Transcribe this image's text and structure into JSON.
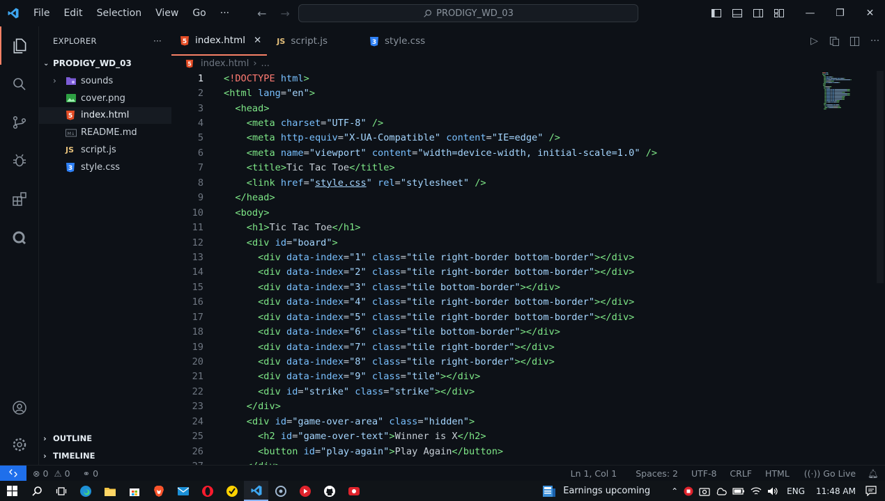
{
  "titlebar": {
    "menu": [
      "File",
      "Edit",
      "Selection",
      "View",
      "Go",
      "···"
    ],
    "search_text": "PRODIGY_WD_03"
  },
  "sidebar": {
    "header": "EXPLORER",
    "more": "···",
    "folder": "PRODIGY_WD_03",
    "items": [
      {
        "label": "sounds",
        "icon": "folder-icon"
      },
      {
        "label": "cover.png",
        "icon": "image-icon"
      },
      {
        "label": "index.html",
        "icon": "html-file-icon"
      },
      {
        "label": "README.md",
        "icon": "markdown-file-icon"
      },
      {
        "label": "script.js",
        "icon": "js-file-icon"
      },
      {
        "label": "style.css",
        "icon": "css-file-icon"
      }
    ],
    "outline": "OUTLINE",
    "timeline": "TIMELINE"
  },
  "tabs": [
    {
      "label": "index.html",
      "icon": "html-file-icon",
      "active": true
    },
    {
      "label": "script.js",
      "icon": "js-file-icon",
      "active": false
    },
    {
      "label": "style.css",
      "icon": "css-file-icon",
      "active": false
    }
  ],
  "breadcrumb": {
    "file": "index.html",
    "rest": "..."
  },
  "code_lines": [
    [
      [
        "p",
        "<"
      ],
      [
        "k",
        "!DOCTYPE"
      ],
      [
        "o",
        " "
      ],
      [
        "a",
        "html"
      ],
      [
        "p",
        ">"
      ]
    ],
    [
      [
        "p",
        "<"
      ],
      [
        "t",
        "html"
      ],
      [
        "o",
        " "
      ],
      [
        "a",
        "lang"
      ],
      [
        "o",
        "="
      ],
      [
        "s",
        "\"en\""
      ],
      [
        "p",
        ">"
      ]
    ],
    [
      [
        "o",
        "  "
      ],
      [
        "p",
        "<"
      ],
      [
        "t",
        "head"
      ],
      [
        "p",
        ">"
      ]
    ],
    [
      [
        "o",
        "    "
      ],
      [
        "p",
        "<"
      ],
      [
        "t",
        "meta"
      ],
      [
        "o",
        " "
      ],
      [
        "a",
        "charset"
      ],
      [
        "o",
        "="
      ],
      [
        "s",
        "\"UTF-8\""
      ],
      [
        "o",
        " "
      ],
      [
        "p",
        "/>"
      ]
    ],
    [
      [
        "o",
        "    "
      ],
      [
        "p",
        "<"
      ],
      [
        "t",
        "meta"
      ],
      [
        "o",
        " "
      ],
      [
        "a",
        "http-equiv"
      ],
      [
        "o",
        "="
      ],
      [
        "s",
        "\"X-UA-Compatible\""
      ],
      [
        "o",
        " "
      ],
      [
        "a",
        "content"
      ],
      [
        "o",
        "="
      ],
      [
        "s",
        "\"IE=edge\""
      ],
      [
        "o",
        " "
      ],
      [
        "p",
        "/>"
      ]
    ],
    [
      [
        "o",
        "    "
      ],
      [
        "p",
        "<"
      ],
      [
        "t",
        "meta"
      ],
      [
        "o",
        " "
      ],
      [
        "a",
        "name"
      ],
      [
        "o",
        "="
      ],
      [
        "s",
        "\"viewport\""
      ],
      [
        "o",
        " "
      ],
      [
        "a",
        "content"
      ],
      [
        "o",
        "="
      ],
      [
        "s",
        "\"width=device-width, initial-scale=1.0\""
      ],
      [
        "o",
        " "
      ],
      [
        "p",
        "/>"
      ]
    ],
    [
      [
        "o",
        "    "
      ],
      [
        "p",
        "<"
      ],
      [
        "t",
        "title"
      ],
      [
        "p",
        ">"
      ],
      [
        "x",
        "Tic Tac Toe"
      ],
      [
        "p",
        "</"
      ],
      [
        "t",
        "title"
      ],
      [
        "p",
        ">"
      ]
    ],
    [
      [
        "o",
        "    "
      ],
      [
        "p",
        "<"
      ],
      [
        "t",
        "link"
      ],
      [
        "o",
        " "
      ],
      [
        "a",
        "href"
      ],
      [
        "o",
        "="
      ],
      [
        "s",
        "\""
      ],
      [
        "l",
        "style.css"
      ],
      [
        "s",
        "\""
      ],
      [
        "o",
        " "
      ],
      [
        "a",
        "rel"
      ],
      [
        "o",
        "="
      ],
      [
        "s",
        "\"stylesheet\""
      ],
      [
        "o",
        " "
      ],
      [
        "p",
        "/>"
      ]
    ],
    [
      [
        "o",
        "  "
      ],
      [
        "p",
        "</"
      ],
      [
        "t",
        "head"
      ],
      [
        "p",
        ">"
      ]
    ],
    [
      [
        "o",
        "  "
      ],
      [
        "p",
        "<"
      ],
      [
        "t",
        "body"
      ],
      [
        "p",
        ">"
      ]
    ],
    [
      [
        "o",
        "    "
      ],
      [
        "p",
        "<"
      ],
      [
        "t",
        "h1"
      ],
      [
        "p",
        ">"
      ],
      [
        "x",
        "Tic Tac Toe"
      ],
      [
        "p",
        "</"
      ],
      [
        "t",
        "h1"
      ],
      [
        "p",
        ">"
      ]
    ],
    [
      [
        "o",
        "    "
      ],
      [
        "p",
        "<"
      ],
      [
        "t",
        "div"
      ],
      [
        "o",
        " "
      ],
      [
        "a",
        "id"
      ],
      [
        "o",
        "="
      ],
      [
        "s",
        "\"board\""
      ],
      [
        "p",
        ">"
      ]
    ],
    [
      [
        "o",
        "      "
      ],
      [
        "p",
        "<"
      ],
      [
        "t",
        "div"
      ],
      [
        "o",
        " "
      ],
      [
        "a",
        "data-index"
      ],
      [
        "o",
        "="
      ],
      [
        "s",
        "\"1\""
      ],
      [
        "o",
        " "
      ],
      [
        "a",
        "class"
      ],
      [
        "o",
        "="
      ],
      [
        "s",
        "\"tile right-border bottom-border\""
      ],
      [
        "p",
        "></"
      ],
      [
        "t",
        "div"
      ],
      [
        "p",
        ">"
      ]
    ],
    [
      [
        "o",
        "      "
      ],
      [
        "p",
        "<"
      ],
      [
        "t",
        "div"
      ],
      [
        "o",
        " "
      ],
      [
        "a",
        "data-index"
      ],
      [
        "o",
        "="
      ],
      [
        "s",
        "\"2\""
      ],
      [
        "o",
        " "
      ],
      [
        "a",
        "class"
      ],
      [
        "o",
        "="
      ],
      [
        "s",
        "\"tile right-border bottom-border\""
      ],
      [
        "p",
        "></"
      ],
      [
        "t",
        "div"
      ],
      [
        "p",
        ">"
      ]
    ],
    [
      [
        "o",
        "      "
      ],
      [
        "p",
        "<"
      ],
      [
        "t",
        "div"
      ],
      [
        "o",
        " "
      ],
      [
        "a",
        "data-index"
      ],
      [
        "o",
        "="
      ],
      [
        "s",
        "\"3\""
      ],
      [
        "o",
        " "
      ],
      [
        "a",
        "class"
      ],
      [
        "o",
        "="
      ],
      [
        "s",
        "\"tile bottom-border\""
      ],
      [
        "p",
        "></"
      ],
      [
        "t",
        "div"
      ],
      [
        "p",
        ">"
      ]
    ],
    [
      [
        "o",
        "      "
      ],
      [
        "p",
        "<"
      ],
      [
        "t",
        "div"
      ],
      [
        "o",
        " "
      ],
      [
        "a",
        "data-index"
      ],
      [
        "o",
        "="
      ],
      [
        "s",
        "\"4\""
      ],
      [
        "o",
        " "
      ],
      [
        "a",
        "class"
      ],
      [
        "o",
        "="
      ],
      [
        "s",
        "\"tile right-border bottom-border\""
      ],
      [
        "p",
        "></"
      ],
      [
        "t",
        "div"
      ],
      [
        "p",
        ">"
      ]
    ],
    [
      [
        "o",
        "      "
      ],
      [
        "p",
        "<"
      ],
      [
        "t",
        "div"
      ],
      [
        "o",
        " "
      ],
      [
        "a",
        "data-index"
      ],
      [
        "o",
        "="
      ],
      [
        "s",
        "\"5\""
      ],
      [
        "o",
        " "
      ],
      [
        "a",
        "class"
      ],
      [
        "o",
        "="
      ],
      [
        "s",
        "\"tile right-border bottom-border\""
      ],
      [
        "p",
        "></"
      ],
      [
        "t",
        "div"
      ],
      [
        "p",
        ">"
      ]
    ],
    [
      [
        "o",
        "      "
      ],
      [
        "p",
        "<"
      ],
      [
        "t",
        "div"
      ],
      [
        "o",
        " "
      ],
      [
        "a",
        "data-index"
      ],
      [
        "o",
        "="
      ],
      [
        "s",
        "\"6\""
      ],
      [
        "o",
        " "
      ],
      [
        "a",
        "class"
      ],
      [
        "o",
        "="
      ],
      [
        "s",
        "\"tile bottom-border\""
      ],
      [
        "p",
        "></"
      ],
      [
        "t",
        "div"
      ],
      [
        "p",
        ">"
      ]
    ],
    [
      [
        "o",
        "      "
      ],
      [
        "p",
        "<"
      ],
      [
        "t",
        "div"
      ],
      [
        "o",
        " "
      ],
      [
        "a",
        "data-index"
      ],
      [
        "o",
        "="
      ],
      [
        "s",
        "\"7\""
      ],
      [
        "o",
        " "
      ],
      [
        "a",
        "class"
      ],
      [
        "o",
        "="
      ],
      [
        "s",
        "\"tile right-border\""
      ],
      [
        "p",
        "></"
      ],
      [
        "t",
        "div"
      ],
      [
        "p",
        ">"
      ]
    ],
    [
      [
        "o",
        "      "
      ],
      [
        "p",
        "<"
      ],
      [
        "t",
        "div"
      ],
      [
        "o",
        " "
      ],
      [
        "a",
        "data-index"
      ],
      [
        "o",
        "="
      ],
      [
        "s",
        "\"8\""
      ],
      [
        "o",
        " "
      ],
      [
        "a",
        "class"
      ],
      [
        "o",
        "="
      ],
      [
        "s",
        "\"tile right-border\""
      ],
      [
        "p",
        "></"
      ],
      [
        "t",
        "div"
      ],
      [
        "p",
        ">"
      ]
    ],
    [
      [
        "o",
        "      "
      ],
      [
        "p",
        "<"
      ],
      [
        "t",
        "div"
      ],
      [
        "o",
        " "
      ],
      [
        "a",
        "data-index"
      ],
      [
        "o",
        "="
      ],
      [
        "s",
        "\"9\""
      ],
      [
        "o",
        " "
      ],
      [
        "a",
        "class"
      ],
      [
        "o",
        "="
      ],
      [
        "s",
        "\"tile\""
      ],
      [
        "p",
        "></"
      ],
      [
        "t",
        "div"
      ],
      [
        "p",
        ">"
      ]
    ],
    [
      [
        "o",
        "      "
      ],
      [
        "p",
        "<"
      ],
      [
        "t",
        "div"
      ],
      [
        "o",
        " "
      ],
      [
        "a",
        "id"
      ],
      [
        "o",
        "="
      ],
      [
        "s",
        "\"strike\""
      ],
      [
        "o",
        " "
      ],
      [
        "a",
        "class"
      ],
      [
        "o",
        "="
      ],
      [
        "s",
        "\"strike\""
      ],
      [
        "p",
        "></"
      ],
      [
        "t",
        "div"
      ],
      [
        "p",
        ">"
      ]
    ],
    [
      [
        "o",
        "    "
      ],
      [
        "p",
        "</"
      ],
      [
        "t",
        "div"
      ],
      [
        "p",
        ">"
      ]
    ],
    [
      [
        "o",
        "    "
      ],
      [
        "p",
        "<"
      ],
      [
        "t",
        "div"
      ],
      [
        "o",
        " "
      ],
      [
        "a",
        "id"
      ],
      [
        "o",
        "="
      ],
      [
        "s",
        "\"game-over-area\""
      ],
      [
        "o",
        " "
      ],
      [
        "a",
        "class"
      ],
      [
        "o",
        "="
      ],
      [
        "s",
        "\"hidden\""
      ],
      [
        "p",
        ">"
      ]
    ],
    [
      [
        "o",
        "      "
      ],
      [
        "p",
        "<"
      ],
      [
        "t",
        "h2"
      ],
      [
        "o",
        " "
      ],
      [
        "a",
        "id"
      ],
      [
        "o",
        "="
      ],
      [
        "s",
        "\"game-over-text\""
      ],
      [
        "p",
        ">"
      ],
      [
        "x",
        "Winner is X"
      ],
      [
        "p",
        "</"
      ],
      [
        "t",
        "h2"
      ],
      [
        "p",
        ">"
      ]
    ],
    [
      [
        "o",
        "      "
      ],
      [
        "p",
        "<"
      ],
      [
        "t",
        "button"
      ],
      [
        "o",
        " "
      ],
      [
        "a",
        "id"
      ],
      [
        "o",
        "="
      ],
      [
        "s",
        "\"play-again\""
      ],
      [
        "p",
        ">"
      ],
      [
        "x",
        "Play Again"
      ],
      [
        "p",
        "</"
      ],
      [
        "t",
        "button"
      ],
      [
        "p",
        ">"
      ]
    ],
    [
      [
        "o",
        "    "
      ],
      [
        "p",
        "</"
      ],
      [
        "t",
        "div"
      ],
      [
        "p",
        ">"
      ]
    ]
  ],
  "current_line": 1,
  "statusbar": {
    "errors": "0",
    "warnings": "0",
    "ports": "0",
    "position": "Ln 1, Col 1",
    "spaces": "Spaces: 2",
    "encoding": "UTF-8",
    "eol": "CRLF",
    "language": "HTML",
    "golive": "Go Live"
  },
  "taskbar": {
    "news": "Earnings upcoming",
    "lang": "ENG",
    "time": "11:48 AM"
  },
  "colors": {
    "accent": "#f78166",
    "remote": "#1f6feb",
    "tag": "#7ee787",
    "attr": "#79c0ff",
    "string": "#a5d6ff",
    "keyword": "#ff7b72"
  }
}
